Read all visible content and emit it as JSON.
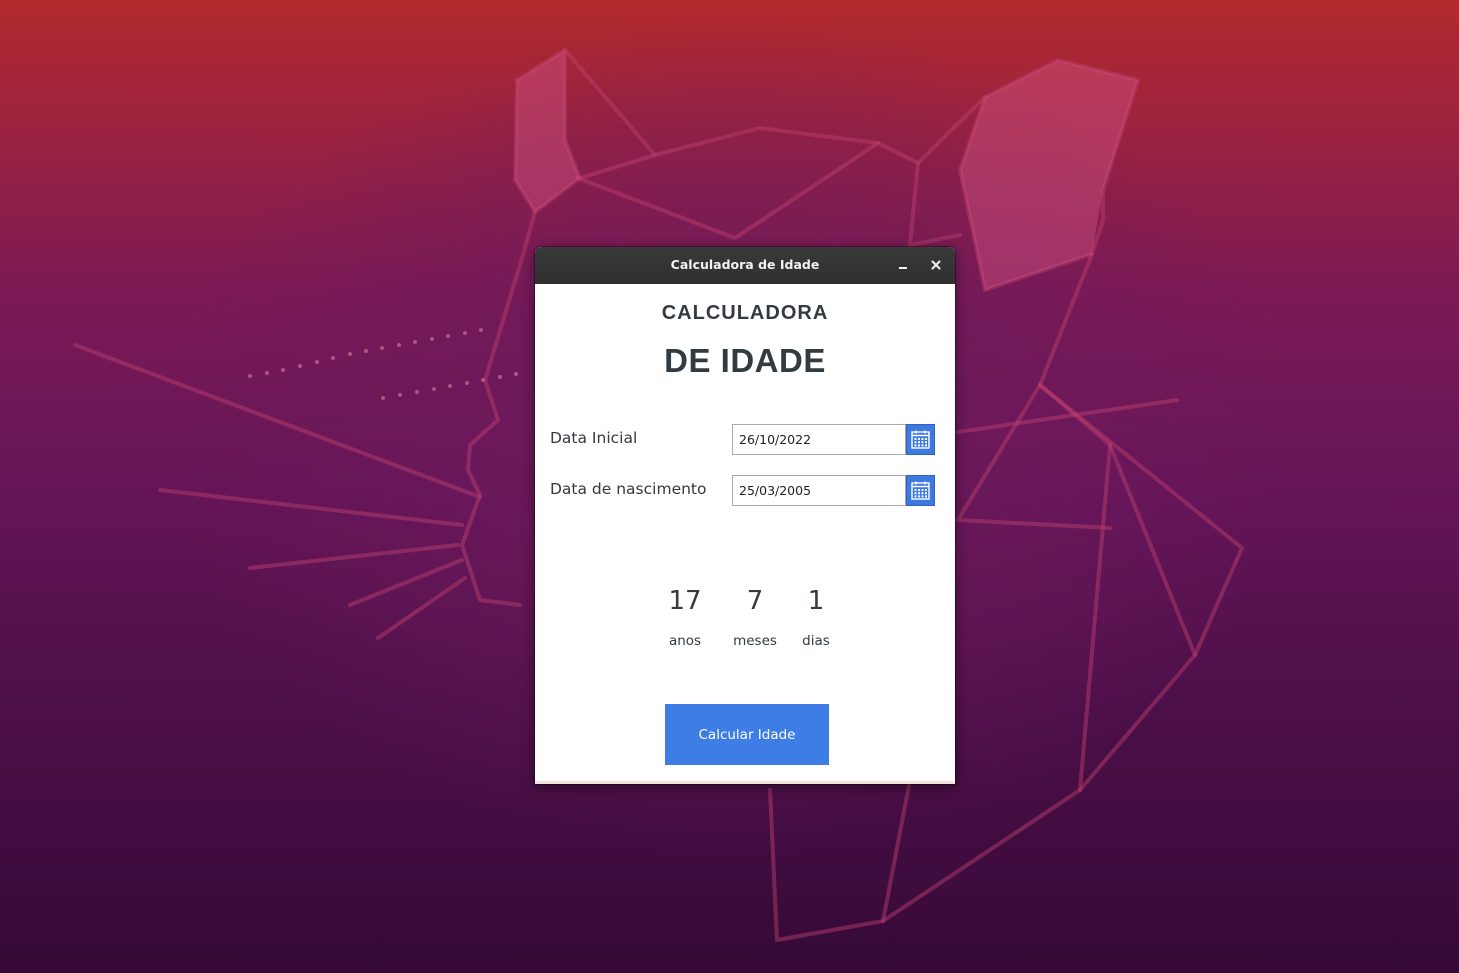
{
  "window": {
    "title": "Calculadora de Idade"
  },
  "app": {
    "heading_line1": "CALCULADORA",
    "heading_line2": "DE IDADE",
    "fields": [
      {
        "label": "Data Inicial",
        "value": "26/10/2022",
        "icon": "calendar-icon"
      },
      {
        "label": "Data de nascimento",
        "value": "25/03/2005",
        "icon": "calendar-icon"
      }
    ],
    "result": {
      "years": {
        "value": "17",
        "unit": "anos"
      },
      "months": {
        "value": "7",
        "unit": "meses"
      },
      "days": {
        "value": "1",
        "unit": "dias"
      }
    },
    "button_label": "Calcular Idade"
  },
  "colors": {
    "accent": "#3f7de6",
    "titlebar": "#303030",
    "text": "#333a40",
    "wallpaper_top": "#b32a2d",
    "wallpaper_bottom": "#360a37"
  }
}
